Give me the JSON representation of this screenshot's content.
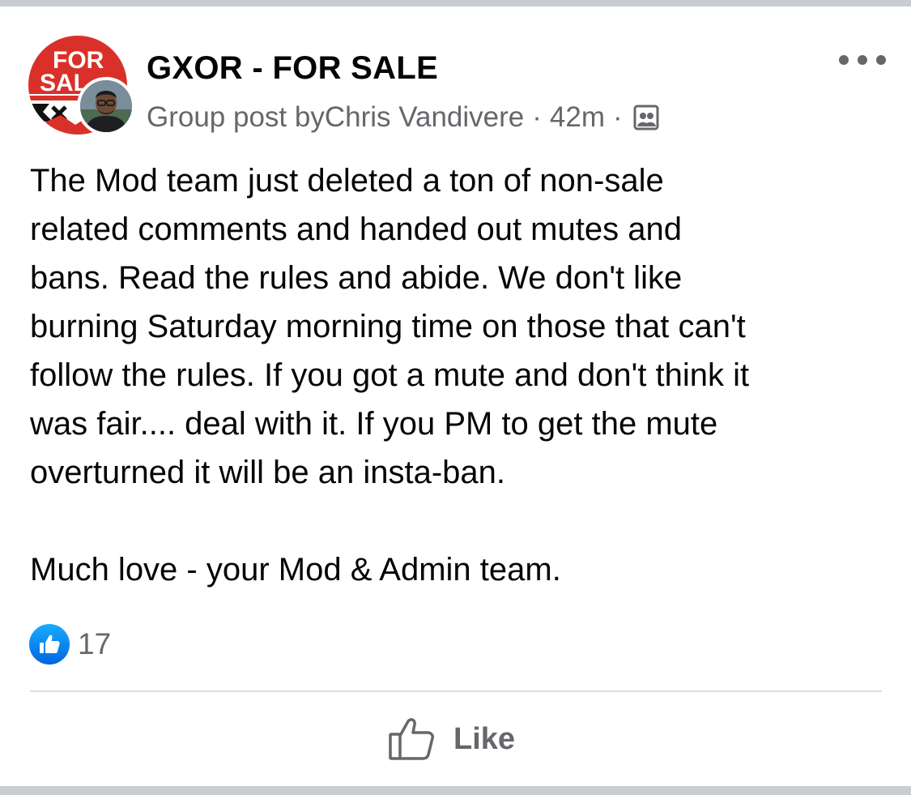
{
  "header": {
    "group_name": "GXOR - FOR SALE",
    "meta": {
      "prefix": "Group post by ",
      "author": "Chris Vandivere",
      "separator": "·",
      "time": "42m",
      "audience_icon": "group-members-icon"
    },
    "group_avatar": {
      "logo_text": "FOR SAL",
      "colors": {
        "red": "#d9312a",
        "white": "#ffffff",
        "black": "#111111"
      }
    },
    "more_icon": "more-options-icon"
  },
  "post": {
    "lines": [
      "The Mod team just deleted a ton of non-sale",
      "related comments and handed out mutes and",
      "bans.  Read the rules and abide.  We don't like",
      "burning Saturday morning time on those that can't",
      "follow the rules.  If you got a mute and don't think it",
      "was fair.... deal with it.  If you PM to get the mute",
      "overturned it will be an insta-ban."
    ],
    "signoff": "Much love - your Mod & Admin team."
  },
  "reactions": {
    "icon": "like-reaction-icon",
    "count": "17",
    "color": "#1877f2"
  },
  "actions": {
    "like_label": "Like",
    "like_icon": "thumbs-up-icon"
  },
  "colors": {
    "text": "#050505",
    "secondary": "#65676b",
    "divider": "#dadde1",
    "frame": "#c9ccd1"
  }
}
